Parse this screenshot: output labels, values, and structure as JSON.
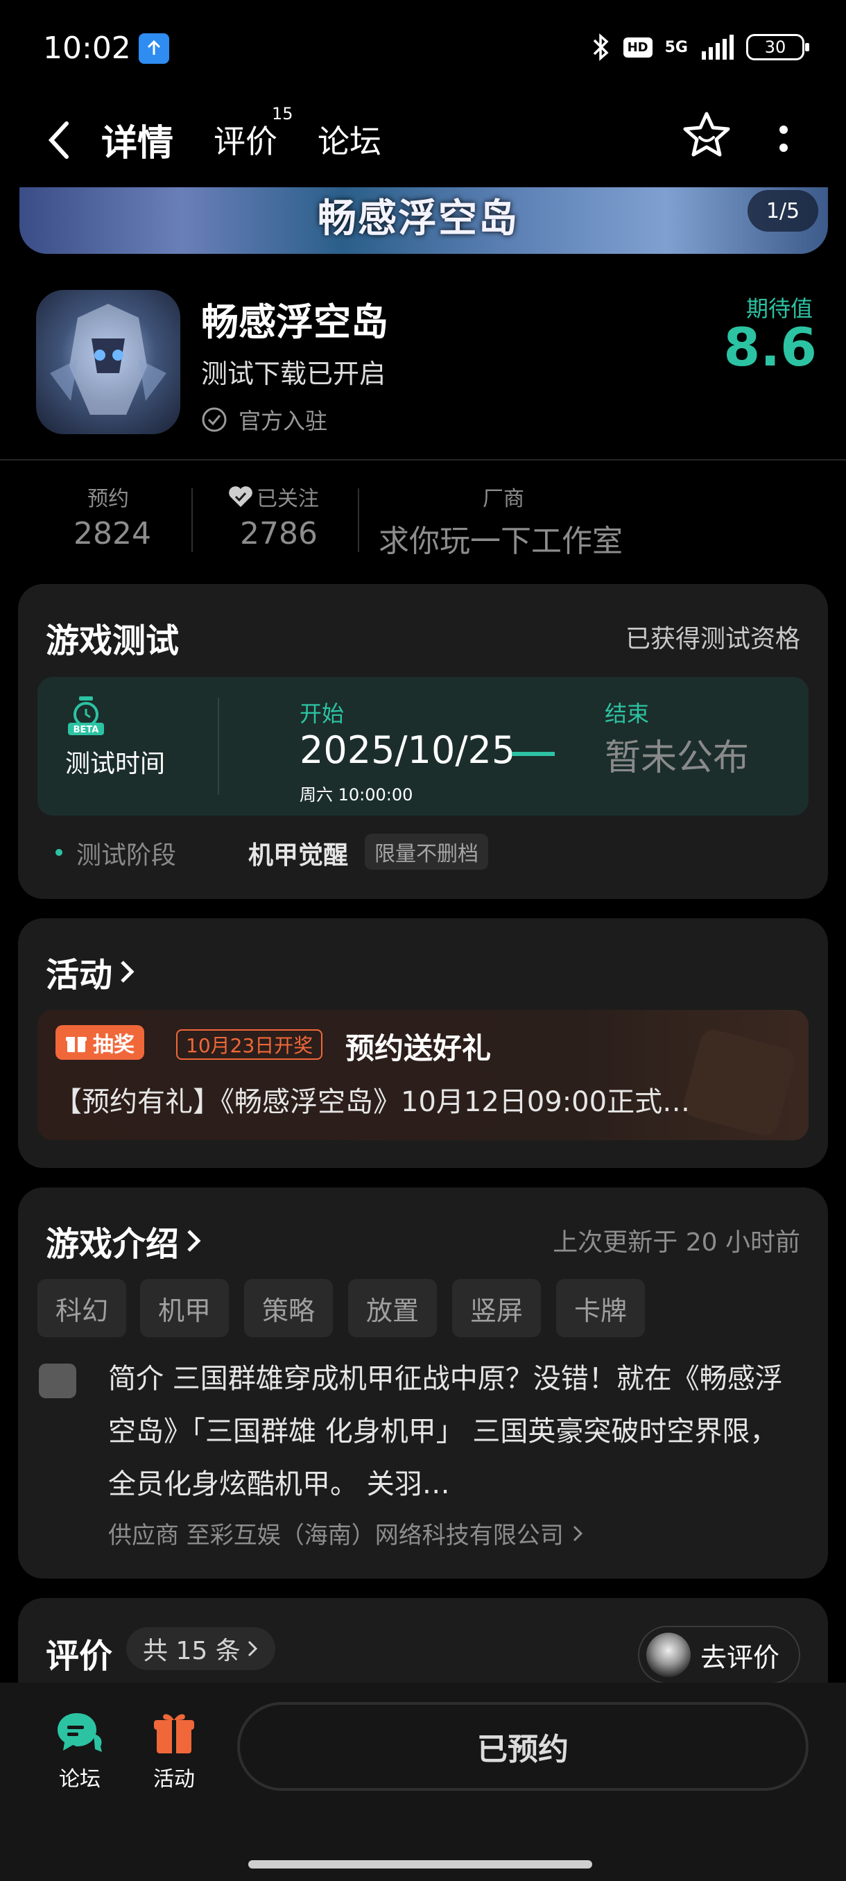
{
  "status_bar": {
    "time": "10:02",
    "hd": "HD",
    "network": "5G",
    "battery": "30"
  },
  "nav": {
    "tabs": [
      {
        "label": "详情",
        "active": true
      },
      {
        "label": "评价",
        "badge": "15"
      },
      {
        "label": "论坛"
      }
    ]
  },
  "banner": {
    "title": "畅感浮空岛",
    "counter": "1/5"
  },
  "app": {
    "name": "畅感浮空岛",
    "subtitle": "测试下载已开启",
    "official": "官方入驻",
    "expect_label": "期待值",
    "expect_value": "8.6"
  },
  "stats": [
    {
      "label": "预约",
      "value": "2824"
    },
    {
      "label": "已关注",
      "value": "2786"
    },
    {
      "label": "厂商",
      "value": "求你玩一下工作室"
    }
  ],
  "game_test": {
    "title": "游戏测试",
    "status": "已获得测试资格",
    "icon_text": "BETA",
    "time_label": "测试时间",
    "start_label": "开始",
    "start_date": "2025/10/25",
    "start_time": "周六  10:00:00",
    "end_label": "结束",
    "end_value": "暂未公布",
    "stage_label": "测试阶段",
    "stage_value": "机甲觉醒",
    "stage_tag": "限量不删档"
  },
  "activity": {
    "title": "活动",
    "lottery_tag": "抽奖",
    "date_tag": "10月23日开奖",
    "item_title": "预约送好礼",
    "item_desc": "【预约有礼】《畅感浮空岛》10月12日09:00正式…"
  },
  "intro": {
    "title": "游戏介绍",
    "updated": "上次更新于 20 小时前",
    "tags": [
      "科幻",
      "机甲",
      "策略",
      "放置",
      "竖屏",
      "卡牌"
    ],
    "text": "简介 三国群雄穿成机甲征战中原？没错！就在《畅感浮空岛》「三国群雄 化身机甲」 三国英豪突破时空界限，全员化身炫酷机甲。 关羽…",
    "supplier": "供应商 至彩互娱（海南）网络科技有限公司"
  },
  "review": {
    "title": "评价",
    "count": "共 15 条",
    "go": "去评价"
  },
  "bottom": {
    "forum": "论坛",
    "activity": "活动",
    "reserved": "已预约"
  },
  "colors": {
    "accent": "#2cc3a3",
    "orange": "#f0683a",
    "card": "#1c1c1c"
  }
}
